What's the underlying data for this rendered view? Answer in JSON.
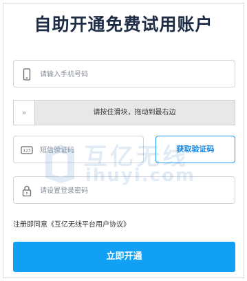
{
  "title": "自助开通免费试用账户",
  "phone": {
    "placeholder": "请输入手机号码",
    "icon": "mobile-phone-icon"
  },
  "slider": {
    "handle": "»",
    "text": "请按住滑块，拖动到最右边"
  },
  "sms": {
    "placeholder": "短信验证码",
    "icon": "sms-code-icon",
    "button": "获取验证码"
  },
  "password": {
    "placeholder": "请设置登录密码",
    "icon": "lock-icon"
  },
  "agreement": {
    "prefix": "注册即同意",
    "link": "《互亿无线平台用户协议》"
  },
  "submit": "立即开通",
  "watermark": {
    "cn": "互亿无线",
    "en": "ihuyi.com"
  },
  "colors": {
    "accent": "#12a0f5",
    "title": "#1e2b45",
    "slider_bg": "#e8e8e8"
  }
}
